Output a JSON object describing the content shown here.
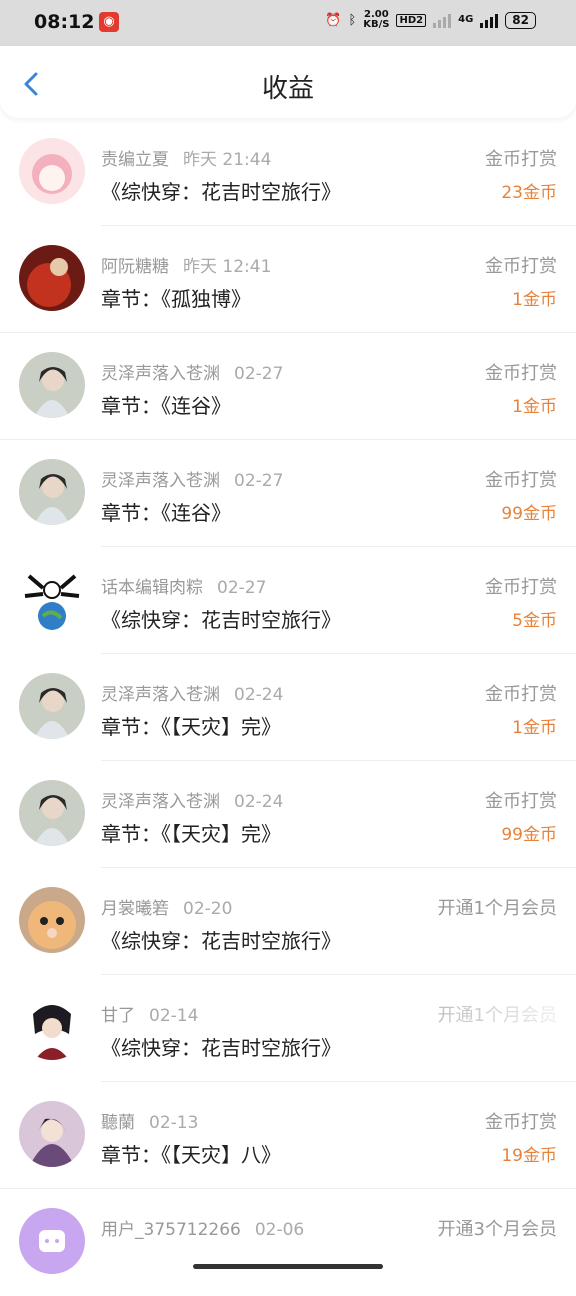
{
  "status": {
    "time": "08:12",
    "speed": "2.00",
    "speed_unit": "KB/S",
    "hd": "HD2",
    "network": "4G",
    "battery": "82"
  },
  "header": {
    "title": "收益"
  },
  "rows": [
    {
      "name": "责编立夏",
      "date": "昨天 21:44",
      "title": "《综快穿：花吉时空旅行》",
      "type": "金币打赏",
      "amount": "23金币"
    },
    {
      "name": "阿阮糖糖",
      "date": "昨天 12:41",
      "title": "章节：《孤独博》",
      "type": "金币打赏",
      "amount": "1金币"
    },
    {
      "name": "灵泽声落入苍渊",
      "date": "02-27",
      "title": "章节：《连谷》",
      "type": "金币打赏",
      "amount": "1金币"
    },
    {
      "name": "灵泽声落入苍渊",
      "date": "02-27",
      "title": "章节：《连谷》",
      "type": "金币打赏",
      "amount": "99金币"
    },
    {
      "name": "话本编辑肉粽",
      "date": "02-27",
      "title": "《综快穿：花吉时空旅行》",
      "type": "金币打赏",
      "amount": "5金币"
    },
    {
      "name": "灵泽声落入苍渊",
      "date": "02-24",
      "title": "章节：《【天灾】完》",
      "type": "金币打赏",
      "amount": "1金币"
    },
    {
      "name": "灵泽声落入苍渊",
      "date": "02-24",
      "title": "章节：《【天灾】完》",
      "type": "金币打赏",
      "amount": "99金币"
    },
    {
      "name": "月裳曦箬",
      "date": "02-20",
      "title": "《综快穿：花吉时空旅行》",
      "type": "开通1个月会员",
      "amount": ""
    },
    {
      "name": "甘了",
      "date": "02-14",
      "title": "《综快穿：花吉时空旅行》",
      "type": "开通1个月会员",
      "amount": ""
    },
    {
      "name": "聽蘭",
      "date": "02-13",
      "title": "章节：《【天灾】八》",
      "type": "金币打赏",
      "amount": "19金币"
    },
    {
      "name": "用户_375712266",
      "date": "02-06",
      "title": "",
      "type": "开通3个月会员",
      "amount": ""
    }
  ],
  "colors": {
    "accent": "#3a86d8",
    "amount": "#e8823a",
    "muted": "#999999"
  }
}
